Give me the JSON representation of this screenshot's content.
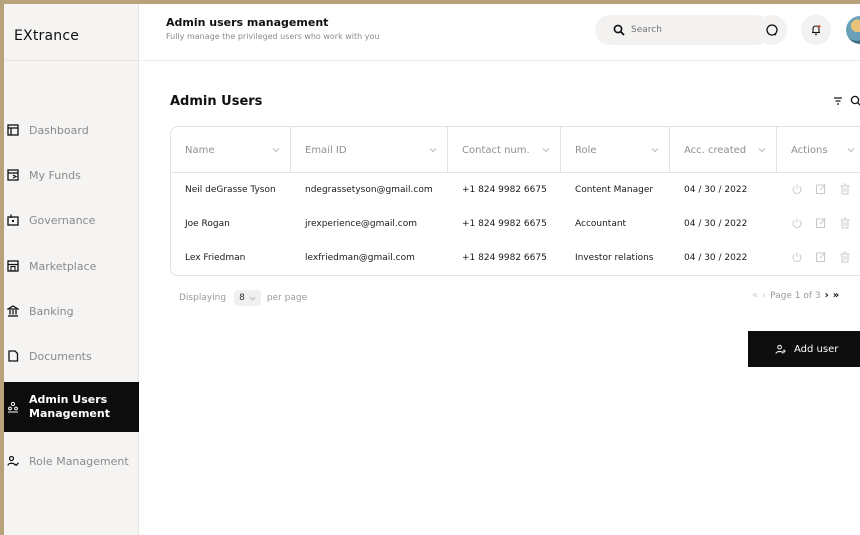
{
  "brand": {
    "name": "EXtrance"
  },
  "sidebar": {
    "items": [
      {
        "label": "Dashboard",
        "icon": "dashboard-icon"
      },
      {
        "label": "My Funds",
        "icon": "funds-icon"
      },
      {
        "label": "Governance",
        "icon": "governance-icon"
      },
      {
        "label": "Marketplace",
        "icon": "marketplace-icon"
      },
      {
        "label": "Banking",
        "icon": "bank-icon"
      },
      {
        "label": "Documents",
        "icon": "document-icon"
      },
      {
        "label": "Admin Users\nManagement",
        "icon": "admin-users-icon",
        "active": true
      },
      {
        "label": "Role Management",
        "icon": "role-icon"
      }
    ]
  },
  "header": {
    "title": "Admin users management",
    "subtitle": "Fully manage the privileged users who work with you",
    "search_placeholder": "Search"
  },
  "main": {
    "title": "Admin Users",
    "columns": [
      "Name",
      "Email ID",
      "Contact num.",
      "Role",
      "Acc. created",
      "Actions"
    ],
    "rows": [
      {
        "name": "Neil deGrasse Tyson",
        "email": "ndegrassetyson@gmail.com",
        "contact": "+1 824 9982 6675",
        "role": "Content Manager",
        "created": "04 / 30 / 2022"
      },
      {
        "name": "Joe Rogan",
        "email": "jrexperience@gmail.com",
        "contact": "+1 824 9982 6675",
        "role": "Accountant",
        "created": "04 / 30 / 2022"
      },
      {
        "name": "Lex Friedman",
        "email": "lexfriedman@gmail.com",
        "contact": "+1 824 9982 6675",
        "role": "Investor relations",
        "created": "04 / 30 / 2022"
      }
    ],
    "pagination": {
      "displaying_label": "Displaying",
      "per_page_value": "8",
      "per_page_label": "per page",
      "page_text": "Page 1 of 3"
    },
    "add_user_label": "Add user"
  },
  "colors": {
    "active_bg": "#0d0d0d",
    "sidebar_bg": "#f5f4f2",
    "frame": "#b8a27a"
  }
}
